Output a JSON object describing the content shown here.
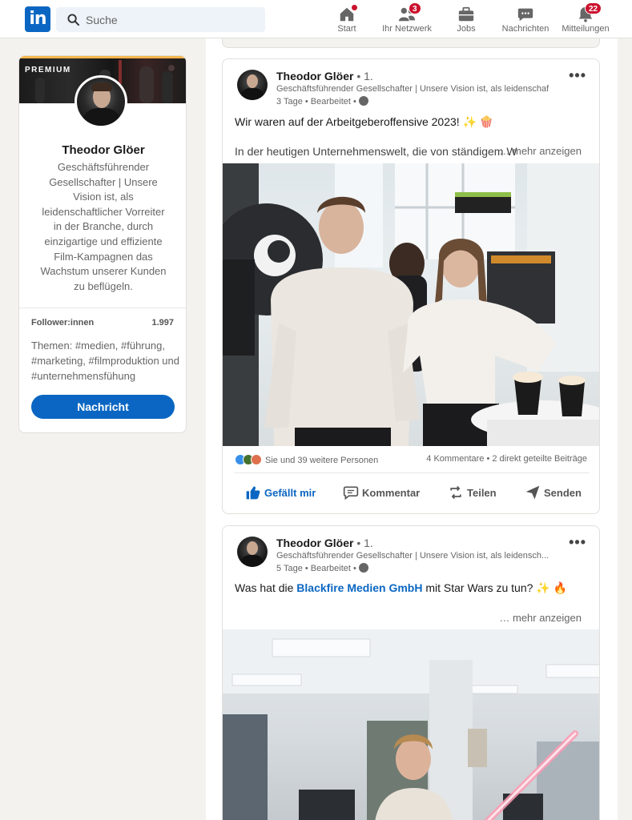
{
  "nav": {
    "logo_text": "in",
    "search_placeholder": "Suche",
    "items": [
      {
        "label": "Start",
        "badge": ""
      },
      {
        "label": "Ihr Netzwerk",
        "badge": "3"
      },
      {
        "label": "Jobs",
        "badge": ""
      },
      {
        "label": "Nachrichten",
        "badge": ""
      },
      {
        "label": "Mitteilungen",
        "badge": "22"
      }
    ]
  },
  "profile": {
    "premium_label": "PREMIUM",
    "name": "Theodor Glöer",
    "description": "Geschäftsführender Gesellschafter | Unsere Vision ist, als leidenschaftlicher Vorreiter in der Branche, durch einzigartige und effiziente Film-Kampagnen das Wachstum unserer Kunden zu beflügeln.",
    "followers_label": "Follower:innen",
    "followers_value": "1.997",
    "themes": "Themen: #medien, #führung, #marketing, #filmproduktion und #unternehmensfühung",
    "message_button": "Nachricht"
  },
  "posts": [
    {
      "author": "Theodor Glöer",
      "degree": "• 1.",
      "headline": "Geschäftsführender Gesellschafter | Unsere Vision ist, als leidenschaftlicher Vorreiter",
      "meta": "3 Tage • Bearbeitet •",
      "text_line1": "Wir waren auf der Arbeitgeberoffensive 2023! ✨ 🍿",
      "text_line2": "In der heutigen Unternehmenswelt, die von ständigem W",
      "more": "… mehr anzeigen",
      "reactions_text": "Sie und 39 weitere Personen",
      "stats": "4 Kommentare • 2 direkt geteilte Beiträge",
      "actions": {
        "like": "Gefällt mir",
        "comment": "Kommentar",
        "share": "Teilen",
        "send": "Senden"
      }
    },
    {
      "author": "Theodor Glöer",
      "degree": "• 1.",
      "headline": "Geschäftsführender Gesellschafter | Unsere Vision ist, als leidensch...",
      "meta": "5 Tage • Bearbeitet •",
      "text_before": "Was hat die ",
      "text_link": "Blackfire Medien GmbH",
      "text_after": " mit Star Wars zu tun? ✨ 🔥",
      "more": "… mehr anzeigen"
    }
  ],
  "colors": {
    "brand_blue": "#0a66c2",
    "badge_red": "#cb112d",
    "premium_gold": "#f5b54a"
  }
}
